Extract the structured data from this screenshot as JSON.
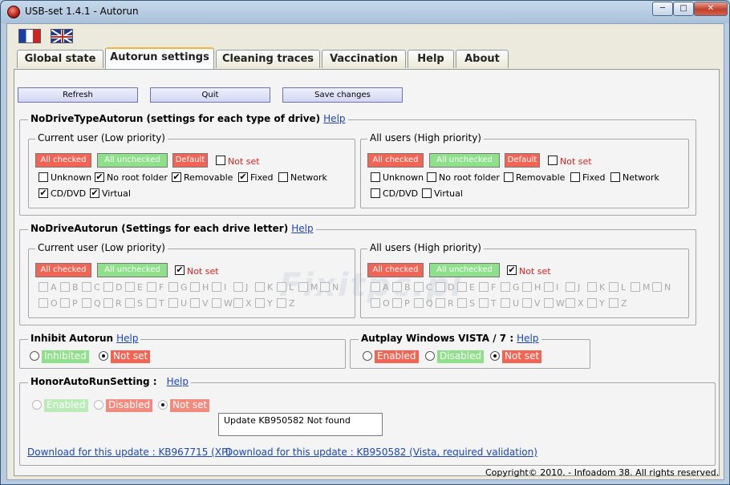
{
  "window": {
    "title": "USB-set 1.4.1 - Autorun",
    "min_label": "─",
    "max_label": "□",
    "close_label": "✕"
  },
  "tabs": [
    {
      "label": "Global state"
    },
    {
      "label": "Autorun settings"
    },
    {
      "label": "Cleaning traces"
    },
    {
      "label": "Vaccination"
    },
    {
      "label": "Help"
    },
    {
      "label": "About"
    }
  ],
  "active_tab": "Autorun settings",
  "toolbar": {
    "refresh": "Refresh",
    "quit": "Quit",
    "save": "Save changes"
  },
  "help_label": "Help",
  "nodrivetype": {
    "title": "NoDriveTypeAutorun (settings for each type of drive)",
    "current": {
      "title": "Current user (Low priority)",
      "all_checked": "All checked",
      "all_unchecked": "All unchecked",
      "default": "Default",
      "not_set": "Not set",
      "not_set_checked": false,
      "items": [
        {
          "label": "Unknown",
          "checked": false
        },
        {
          "label": "No root folder",
          "checked": true
        },
        {
          "label": "Removable",
          "checked": true
        },
        {
          "label": "Fixed",
          "checked": true
        },
        {
          "label": "Network",
          "checked": false
        },
        {
          "label": "CD/DVD",
          "checked": true
        },
        {
          "label": "Virtual",
          "checked": true
        }
      ]
    },
    "all": {
      "title": "All users (High priority)",
      "all_checked": "All checked",
      "all_unchecked": "All unchecked",
      "default": "Default",
      "not_set": "Not set",
      "not_set_checked": false,
      "items": [
        {
          "label": "Unknown",
          "checked": false
        },
        {
          "label": "No root folder",
          "checked": false
        },
        {
          "label": "Removable",
          "checked": false
        },
        {
          "label": "Fixed",
          "checked": false
        },
        {
          "label": "Network",
          "checked": false
        },
        {
          "label": "CD/DVD",
          "checked": false
        },
        {
          "label": "Virtual",
          "checked": false
        }
      ]
    }
  },
  "nodrive": {
    "title": "NoDriveAutorun (Settings for each drive letter)",
    "current": {
      "title": "Current user (Low priority)",
      "all_checked": "All checked",
      "all_unchecked": "All unchecked",
      "not_set": "Not set",
      "not_set_checked": true
    },
    "all": {
      "title": "All users (High priority)",
      "all_checked": "All checked",
      "all_unchecked": "All unchecked",
      "not_set": "Not set",
      "not_set_checked": true
    },
    "letters_row1": [
      "A",
      "B",
      "C",
      "D",
      "E",
      "F",
      "G",
      "H",
      "I",
      "J",
      "K",
      "L",
      "M",
      "N"
    ],
    "letters_row2": [
      "O",
      "P",
      "Q",
      "R",
      "S",
      "T",
      "U",
      "V",
      "W",
      "X",
      "Y",
      "Z"
    ]
  },
  "inhibit": {
    "title": "Inhibit Autorun",
    "inhibited": "Inhibited",
    "not_set": "Not set",
    "selected": "Not set"
  },
  "autoplay": {
    "title": "Autplay Windows VISTA / 7 :",
    "enabled": "Enabled",
    "disabled": "Disabled",
    "not_set": "Not set",
    "selected": "Not set"
  },
  "honor": {
    "title": "HonorAutoRunSetting :",
    "enabled": "Enabled",
    "disabled": "Disabled",
    "not_set": "Not set",
    "selected": "Not set",
    "status": "Update KB950582 Not found"
  },
  "links": {
    "xp": "Download for this update : KB967715 (XP)",
    "vista": "Download for this update : KB950582 (Vista, required validation)"
  },
  "footer": {
    "copyright": "Copyright© 2010. - Infoadom 38. All rights reserved."
  },
  "watermark": "Fixitpc.pl",
  "colors": {
    "red": "#f26454",
    "green": "#8ee08a",
    "link": "#1c46c0",
    "tab_accent": "#f5b53a"
  }
}
